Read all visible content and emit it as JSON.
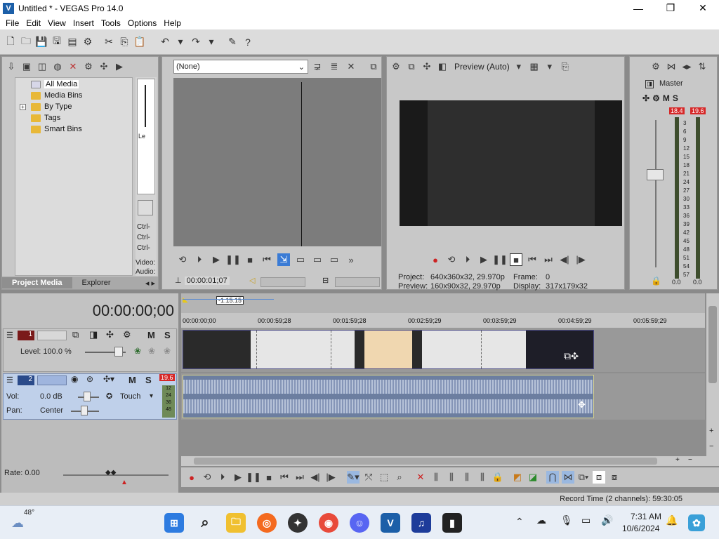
{
  "window": {
    "title": "Untitled * - VEGAS Pro 14.0",
    "app_icon": "vegas-logo"
  },
  "menu": [
    "File",
    "Edit",
    "View",
    "Insert",
    "Tools",
    "Options",
    "Help"
  ],
  "media": {
    "tree": [
      "All Media",
      "Media Bins",
      "By Type",
      "Tags",
      "Smart Bins"
    ],
    "side_labels": [
      "Le",
      "Ctrl-",
      "Ctrl-",
      "Ctrl-",
      "Video:",
      "Audio:"
    ],
    "tabs": [
      "Project Media",
      "Explorer"
    ]
  },
  "trimmer": {
    "dropdown": "(None)",
    "timecode": "00:00:01;07"
  },
  "preview": {
    "mode": "Preview (Auto)",
    "project_label": "Project:",
    "project_value": "640x360x32, 29.970p",
    "preview_label": "Preview:",
    "preview_value": "160x90x32, 29.970p",
    "frame_label": "Frame:",
    "frame_value": "0",
    "display_label": "Display:",
    "display_value": "317x179x32"
  },
  "master": {
    "label": "Master",
    "peak_left": "18.4",
    "peak_right": "19.6",
    "scale": [
      "3",
      "6",
      "9",
      "12",
      "15",
      "18",
      "21",
      "24",
      "27",
      "30",
      "33",
      "36",
      "39",
      "42",
      "45",
      "48",
      "51",
      "54",
      "57"
    ],
    "bottom_left": "0.0",
    "bottom_right": "0.0"
  },
  "timeline": {
    "timecode": "00:00:00;00",
    "selection_length": "-1:15:15",
    "ruler": [
      "00:00:00;00",
      "00:00:59;28",
      "00:01:59;28",
      "00:02:59;29",
      "00:03:59;29",
      "00:04:59;29",
      "00:05:59;29"
    ],
    "track1": {
      "number": "1",
      "level": "Level: 100.0 %",
      "m": "M",
      "s": "S"
    },
    "track2": {
      "number": "2",
      "vol_label": "Vol:",
      "vol_value": "0.0 dB",
      "pan_label": "Pan:",
      "pan_value": "Center",
      "auto_mode": "Touch",
      "peak": "19.6",
      "meter_scale": [
        "12",
        "24",
        "36",
        "48"
      ],
      "m": "M",
      "s": "S"
    },
    "rate": "Rate: 0.00",
    "record_time": "Record Time (2 channels): 59:30:05"
  },
  "taskbar": {
    "weather_temp": "48°",
    "time": "7:31 AM",
    "date": "10/6/2024"
  },
  "colors": {
    "peak_red": "#d62828",
    "title_bg": "#ffffff",
    "panel_bg": "#c8c8c8"
  }
}
